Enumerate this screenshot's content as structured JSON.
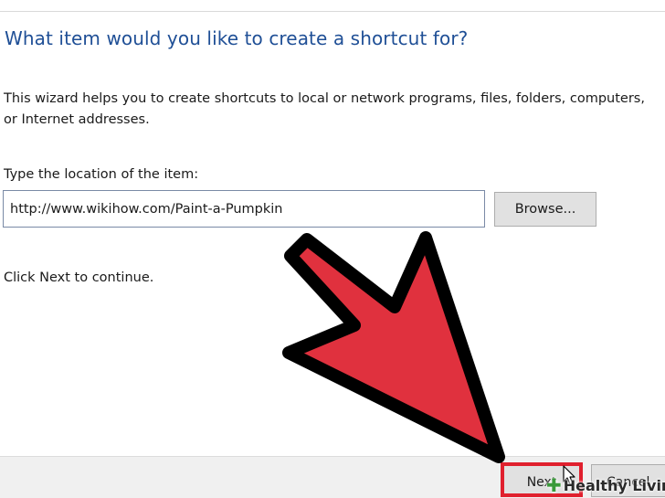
{
  "wizard": {
    "heading": "What item would you like to create a shortcut for?",
    "description": "This wizard helps you to create shortcuts to local or network programs, files, folders, computers, or Internet addresses.",
    "location_label": "Type the location of the item:",
    "location_value": "http://www.wikihow.com/Paint-a-Pumpkin",
    "browse_label": "Browse...",
    "continue_text": "Click Next to continue."
  },
  "footer": {
    "next_label": "Next",
    "cancel_label": "Cancel"
  },
  "overlay": {
    "arrow_color": "#e0313e",
    "highlight_color": "#e0202e",
    "watermark_text": "Healthy Living",
    "watermark_icon": "plus-icon"
  }
}
